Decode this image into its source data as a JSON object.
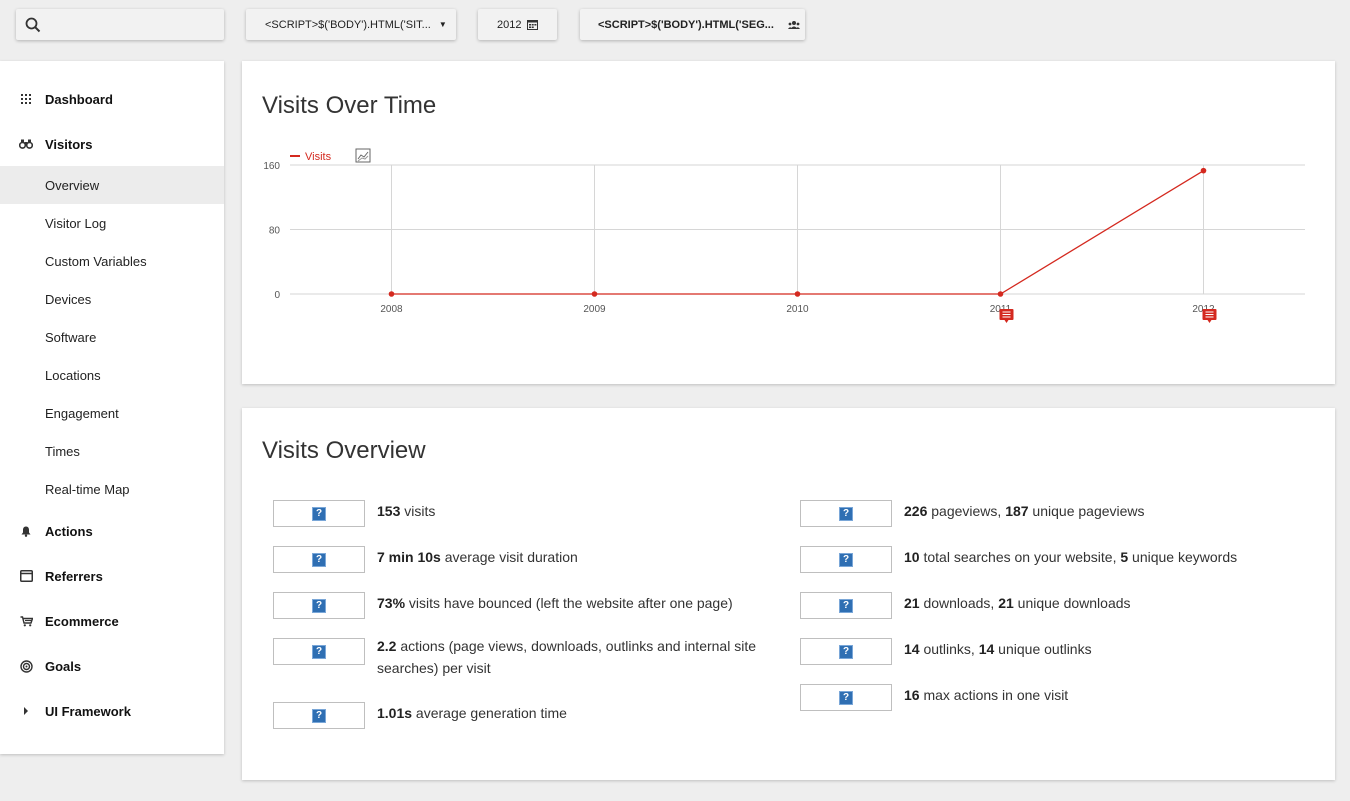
{
  "topbar": {
    "search_placeholder": "",
    "site_selector_label": "<SCRIPT>$('BODY').HTML('SIT...",
    "date_label": "2012",
    "segment_label": "<SCRIPT>$('BODY').HTML('SEG..."
  },
  "sidebar": {
    "categories": [
      {
        "label": "Dashboard",
        "icon": "grid-icon"
      },
      {
        "label": "Visitors",
        "icon": "binoculars-icon"
      },
      {
        "label": "Actions",
        "icon": "bell-icon"
      },
      {
        "label": "Referrers",
        "icon": "browser-window-icon"
      },
      {
        "label": "Ecommerce",
        "icon": "cart-icon"
      },
      {
        "label": "Goals",
        "icon": "target-icon"
      },
      {
        "label": "UI Framework",
        "icon": "caret-right-icon"
      }
    ],
    "visitors_items": [
      {
        "label": "Overview",
        "active": true
      },
      {
        "label": "Visitor Log"
      },
      {
        "label": "Custom Variables"
      },
      {
        "label": "Devices"
      },
      {
        "label": "Software"
      },
      {
        "label": "Locations"
      },
      {
        "label": "Engagement"
      },
      {
        "label": "Times"
      },
      {
        "label": "Real-time Map"
      }
    ]
  },
  "visits_over_time": {
    "title": "Visits Over Time",
    "legend_label": "Visits"
  },
  "chart_data": {
    "type": "line",
    "x": [
      "2008",
      "2009",
      "2010",
      "2011",
      "2012"
    ],
    "series": [
      {
        "name": "Visits",
        "values": [
          0,
          0,
          0,
          0,
          153
        ]
      }
    ],
    "yticks": [
      0,
      80,
      160
    ],
    "ylim": [
      0,
      160
    ],
    "annotations_at": [
      "2011",
      "2012"
    ],
    "color": "#d4291f",
    "grid": true,
    "legend_position": "top-left"
  },
  "visits_overview": {
    "title": "Visits Overview",
    "left": [
      {
        "parts": [
          {
            "b": "153"
          },
          {
            "t": " visits"
          }
        ]
      },
      {
        "parts": [
          {
            "b": "7 min 10s"
          },
          {
            "t": " average visit duration"
          }
        ]
      },
      {
        "parts": [
          {
            "b": "73%"
          },
          {
            "t": " visits have bounced (left the website after one page)"
          }
        ]
      },
      {
        "parts": [
          {
            "b": "2.2"
          },
          {
            "t": " actions (page views, downloads, outlinks and internal site searches) per visit"
          }
        ]
      },
      {
        "parts": [
          {
            "b": "1.01s"
          },
          {
            "t": " average generation time"
          }
        ]
      }
    ],
    "right": [
      {
        "parts": [
          {
            "b": "226"
          },
          {
            "t": " pageviews, "
          },
          {
            "b": "187"
          },
          {
            "t": " unique pageviews"
          }
        ]
      },
      {
        "parts": [
          {
            "b": "10"
          },
          {
            "t": " total searches on your website, "
          },
          {
            "b": "5"
          },
          {
            "t": " unique keywords"
          }
        ]
      },
      {
        "parts": [
          {
            "b": "21"
          },
          {
            "t": " downloads, "
          },
          {
            "b": "21"
          },
          {
            "t": " unique downloads"
          }
        ]
      },
      {
        "parts": [
          {
            "b": "14"
          },
          {
            "t": " outlinks, "
          },
          {
            "b": "14"
          },
          {
            "t": " unique outlinks"
          }
        ]
      },
      {
        "parts": [
          {
            "b": "16"
          },
          {
            "t": " max actions in one visit"
          }
        ]
      }
    ],
    "placeholder_glyph": "?"
  }
}
